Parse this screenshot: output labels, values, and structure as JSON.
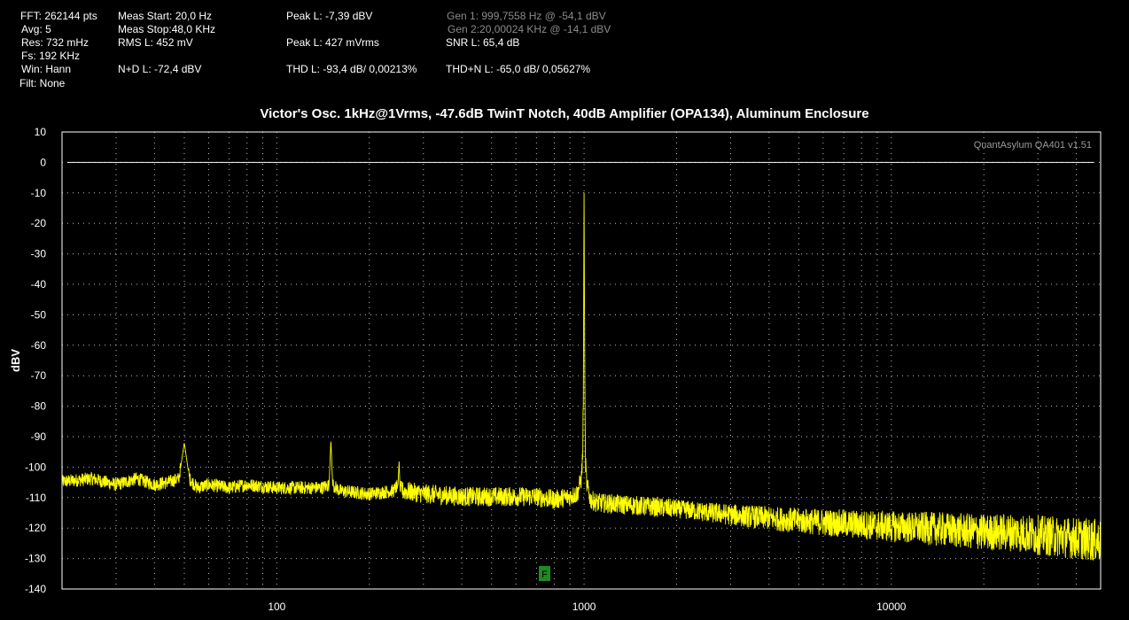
{
  "stats": {
    "fft": "FFT: 262144 pts",
    "avg": "Avg: 5",
    "res": "Res: 732 mHz",
    "fs": "Fs: 192 KHz",
    "win": "Win: Hann",
    "filt": "Filt: None",
    "meas_start": "Meas Start: 20,0 Hz",
    "meas_stop": "Meas Stop:48,0 KHz",
    "rms": "RMS L: 452 mV",
    "nd": "N+D L: -72,4 dBV",
    "peak_dbv": "Peak L: -7,39 dBV",
    "peak_mv": "Peak L: 427 mVrms",
    "thd": "THD L: -93,4 dB/ 0,00213%",
    "gen1": "Gen 1: 999,7558 Hz @ -54,1  dBV",
    "gen2": "Gen 2:20,00024 KHz @ -14,1  dBV",
    "snr": "SNR L: 65,4 dB",
    "thdn": "THD+N L: -65,0 dB/ 0,05627%"
  },
  "watermark": "QuantAsylum QA401 v1.51",
  "marker_label": "F",
  "colors": {
    "trace": "#ffff00",
    "background": "#000000",
    "grid": "#bdbdbd",
    "marker": "#1f8a1f",
    "dim_text": "#8a8a8a"
  },
  "chart_data": {
    "type": "line",
    "title": "Victor's Osc. 1kHz@1Vrms, -47.6dB TwinT Notch, 40dB Amplifier (OPA134), Aluminum Enclosure",
    "xlabel": "",
    "ylabel": "dBV",
    "x_scale": "log",
    "xlim": [
      20,
      48000
    ],
    "ylim": [
      -140,
      10
    ],
    "yticks": [
      10,
      0,
      -10,
      -20,
      -30,
      -40,
      -50,
      -60,
      -70,
      -80,
      -90,
      -100,
      -110,
      -120,
      -130,
      -140
    ],
    "xticks": [
      100,
      1000,
      10000
    ],
    "xtick_labels": [
      "100",
      "1000",
      "10000"
    ],
    "grid": true,
    "reference_line_y": 0,
    "series": [
      {
        "x": [
          20,
          25,
          30,
          35,
          40,
          45,
          48,
          50,
          52,
          55,
          60,
          70,
          80,
          100,
          120,
          140,
          148,
          150,
          152,
          160,
          200,
          240,
          248,
          250,
          252,
          300,
          400,
          500,
          600,
          700,
          800,
          900,
          950,
          980,
          990,
          995,
          999.76,
          1005,
          1010,
          1020,
          1050,
          1100,
          1500,
          2000,
          3000,
          5000,
          7000,
          10000,
          15000,
          20000,
          25000,
          30000,
          40000,
          48000
        ],
        "y": [
          -105,
          -104,
          -106,
          -104,
          -106,
          -105,
          -104,
          -92,
          -104,
          -107,
          -106,
          -107,
          -106,
          -107,
          -107,
          -107,
          -106,
          -91,
          -106,
          -108,
          -109,
          -108,
          -106,
          -98,
          -108,
          -109,
          -110,
          -110,
          -110,
          -110,
          -111,
          -110,
          -109,
          -104,
          -96,
          -75,
          -7.4,
          -68,
          -98,
          -106,
          -111,
          -112,
          -113,
          -114,
          -116,
          -118,
          -119,
          -120,
          -121,
          -122,
          -122,
          -123,
          -124,
          -125
        ]
      }
    ]
  }
}
